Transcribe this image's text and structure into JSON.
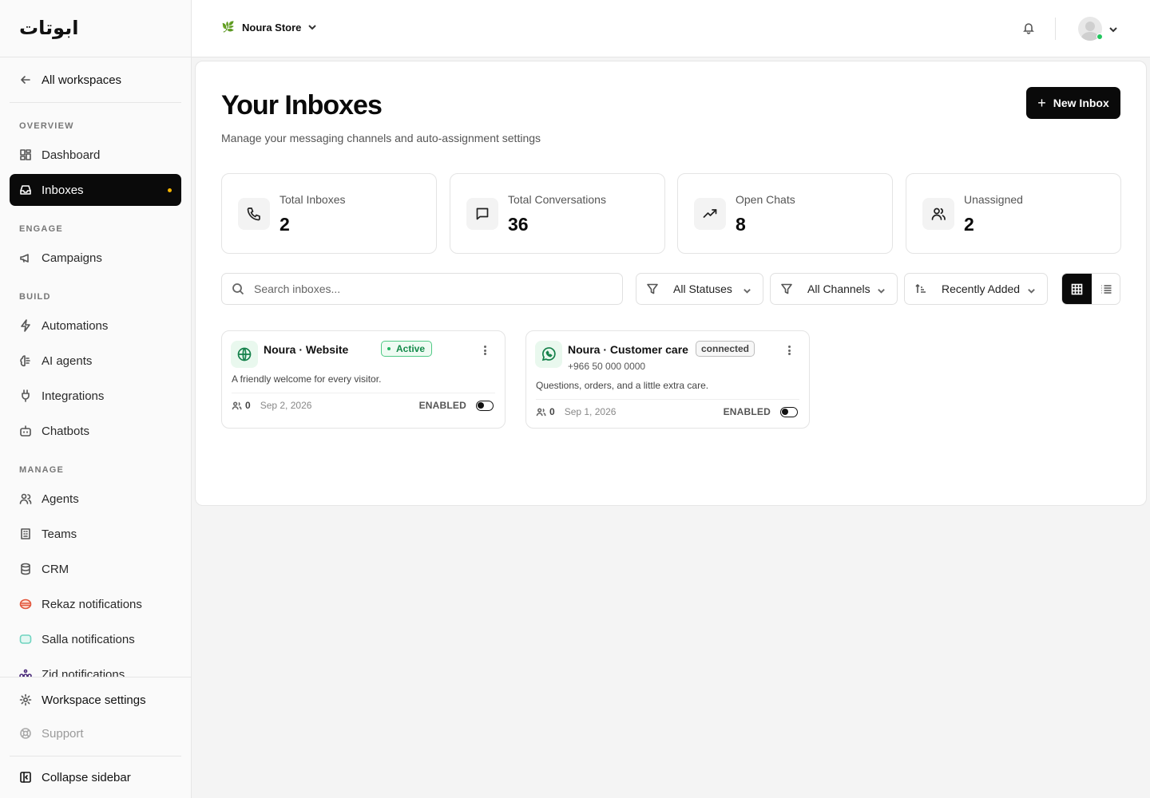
{
  "brand": {
    "logo_text": "ابوتات"
  },
  "sidebar": {
    "back_label": "All workspaces",
    "sections": {
      "overview": "OVERVIEW",
      "engage": "ENGAGE",
      "build": "BUILD",
      "manage": "MANAGE"
    },
    "items": {
      "dashboard": "Dashboard",
      "inboxes": "Inboxes",
      "campaigns": "Campaigns",
      "automations": "Automations",
      "ai_agents": "AI agents",
      "integrations": "Integrations",
      "chatbots": "Chatbots",
      "agents": "Agents",
      "teams": "Teams",
      "crm": "CRM",
      "rekaz": "Rekaz notifications",
      "salla": "Salla notifications",
      "zid": "Zid notifications"
    },
    "footer": {
      "settings": "Workspace settings",
      "support": "Support",
      "collapse": "Collapse sidebar"
    },
    "active_item": "inboxes",
    "active_dot_color": "#f5b400"
  },
  "topbar": {
    "store_name": "Noura Store",
    "user_status_color": "#22c55e"
  },
  "main": {
    "title": "Your Inboxes",
    "subtitle": "Manage your messaging channels and auto-assignment settings",
    "new_button": "New Inbox",
    "stats": [
      {
        "label": "Total Inboxes",
        "value": "2",
        "icon": "phone-icon"
      },
      {
        "label": "Total Conversations",
        "value": "36",
        "icon": "message-square-icon"
      },
      {
        "label": "Open Chats",
        "value": "8",
        "icon": "trending-up-icon"
      },
      {
        "label": "Unassigned",
        "value": "2",
        "icon": "users-icon"
      }
    ],
    "search": {
      "placeholder": "Search inboxes..."
    },
    "filters": {
      "status": "All Statuses",
      "channel": "All Channels",
      "sort": "Recently Added"
    },
    "view_mode": "grid",
    "inboxes": [
      {
        "name": "Noura · Website",
        "badge": "Active",
        "description": "A friendly welcome for every visitor.",
        "agent_count": "0",
        "date": "Sep 2, 2026",
        "state": "ENABLED",
        "channel_icon": "globe-icon"
      },
      {
        "name": "Noura · Customer care",
        "badge": "connected",
        "phone": "+966 50 000 0000",
        "description": "Questions, orders, and a little extra care.",
        "agent_count": "0",
        "date": "Sep 1, 2026",
        "state": "ENABLED",
        "channel_icon": "whatsapp-icon"
      }
    ]
  }
}
